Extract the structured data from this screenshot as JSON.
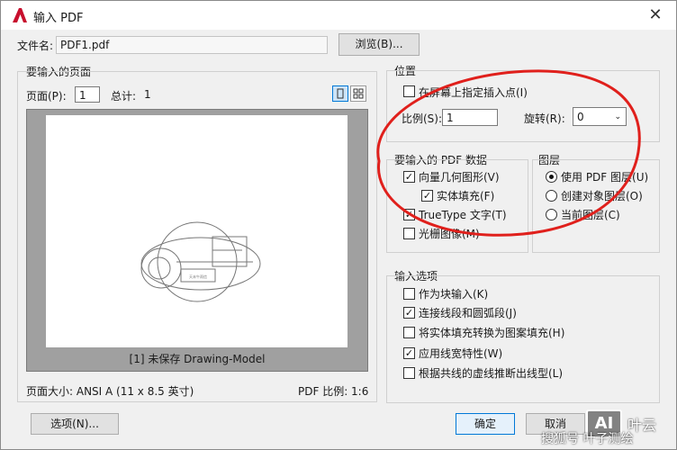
{
  "window": {
    "title": "输入 PDF",
    "app_icon": "autocad-a-icon",
    "close_glyph": "✕"
  },
  "file": {
    "label": "文件名:",
    "value": "PDF1.pdf",
    "browse_label": "浏览(B)...",
    "browse_hotkey": "B"
  },
  "pages": {
    "group_title": "要输入的页面",
    "page_label": "页面(P):",
    "page_value": "1",
    "total_label": "总计:",
    "total_value": "1",
    "preview_caption": "[1] 未保存 Drawing-Model",
    "preview_thumb_text": "天未午雨信",
    "page_size": "页面大小: ANSI A (11 x 8.5 英寸)",
    "pdf_scale": "PDF 比例: 1:6"
  },
  "position": {
    "group_title": "位置",
    "specify_on_screen": {
      "label": "在屏幕上指定插入点(I)",
      "checked": false
    },
    "scale_label": "比例(S):",
    "scale_value": "1",
    "rotation_label": "旋转(R):",
    "rotation_value": "0"
  },
  "pdf_data": {
    "group_title": "要输入的 PDF 数据",
    "items": [
      {
        "label": "向量几何图形(V)",
        "checked": true
      },
      {
        "label": "实体填充(F)",
        "checked": true
      },
      {
        "label": "TrueType 文字(T)",
        "checked": true
      },
      {
        "label": "光栅图像(M)",
        "checked": false
      }
    ]
  },
  "layers": {
    "group_title": "图层",
    "options": [
      {
        "label": "使用 PDF 图层(U)",
        "selected": true
      },
      {
        "label": "创建对象图层(O)",
        "selected": false
      },
      {
        "label": "当前图层(C)",
        "selected": false
      }
    ]
  },
  "import_options": {
    "group_title": "输入选项",
    "items": [
      {
        "label": "作为块输入(K)",
        "checked": false
      },
      {
        "label": "连接线段和圆弧段(J)",
        "checked": true
      },
      {
        "label": "将实体填充转换为图案填充(H)",
        "checked": false
      },
      {
        "label": "应用线宽特性(W)",
        "checked": true
      },
      {
        "label": "根据共线的虚线推断出线型(L)",
        "checked": false
      }
    ]
  },
  "footer": {
    "options_label": "选项(N)...",
    "ok_label": "确定",
    "cancel_label": "取消"
  },
  "watermark": {
    "logo": "AI",
    "text1": "叶云",
    "text2": "搜狐号 叶子测绘"
  },
  "colors": {
    "annotation": "#e0201c",
    "accent": "#0078d7",
    "acad_red": "#c8102e"
  }
}
